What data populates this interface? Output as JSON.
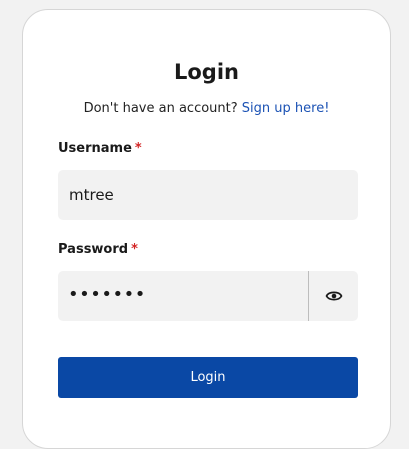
{
  "login": {
    "title": "Login",
    "signup_prompt": "Don't have an account?",
    "signup_link": "Sign up here!",
    "username_label": "Username",
    "username_value": "mtree",
    "password_label": "Password",
    "password_value": "•••••••",
    "required_marker": "*",
    "submit_label": "Login"
  },
  "icons": {
    "password_toggle": "eye-icon"
  },
  "colors": {
    "accent": "#0a48a5",
    "link": "#1b52b4",
    "required": "#d32626",
    "field_bg": "#f2f2f2"
  }
}
